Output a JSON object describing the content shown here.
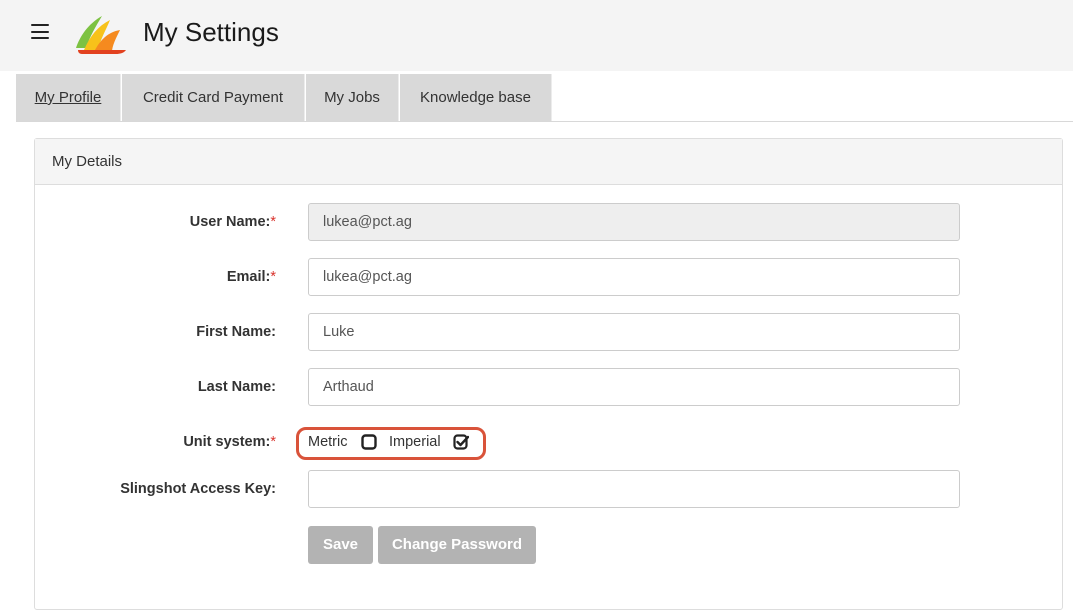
{
  "header": {
    "title": "My Settings"
  },
  "tabs": [
    {
      "label": "My Profile",
      "active": true
    },
    {
      "label": "Credit Card Payment",
      "active": false
    },
    {
      "label": "My Jobs",
      "active": false
    },
    {
      "label": "Knowledge base",
      "active": false
    }
  ],
  "panel": {
    "title": "My Details",
    "fields": {
      "username": {
        "label": "User Name:",
        "required": "*",
        "value": "lukea@pct.ag"
      },
      "email": {
        "label": "Email:",
        "required": "*",
        "value": "lukea@pct.ag"
      },
      "first_name": {
        "label": "First Name:",
        "value": "Luke"
      },
      "last_name": {
        "label": "Last Name:",
        "value": "Arthaud"
      },
      "unit_system": {
        "label": "Unit system:",
        "required": "*",
        "options": [
          {
            "label": "Metric",
            "checked": false
          },
          {
            "label": "Imperial",
            "checked": true
          }
        ]
      },
      "slingshot_key": {
        "label": "Slingshot Access Key:",
        "value": ""
      }
    },
    "buttons": {
      "save": "Save",
      "change_password": "Change Password"
    }
  },
  "colors": {
    "header_bg": "#f4f4f4",
    "tab_bg": "#d9d9d9",
    "required": "#d9322c",
    "highlight": "#d9533a",
    "button_bg": "#b3b3b3"
  },
  "icons": {
    "menu": "hamburger-menu-icon",
    "logo": "app-logo",
    "unchecked": "checkbox-unchecked-icon",
    "checked": "checkbox-checked-icon"
  }
}
